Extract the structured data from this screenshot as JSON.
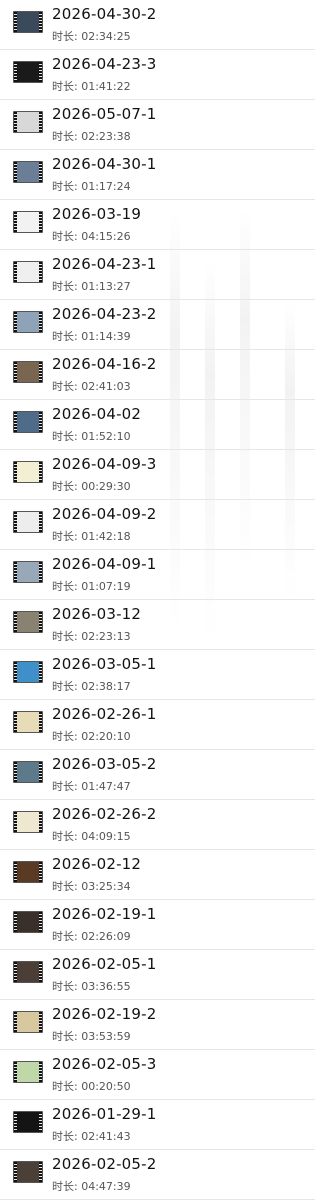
{
  "duration_prefix": "时长: ",
  "items": [
    {
      "title": "2026-04-30-2",
      "duration": "02:34:25",
      "thumb_color": "#3a4a5a"
    },
    {
      "title": "2026-04-23-3",
      "duration": "01:41:22",
      "thumb_color": "#1a1a1a"
    },
    {
      "title": "2026-05-07-1",
      "duration": "02:23:38",
      "thumb_color": "#d8d8d8"
    },
    {
      "title": "2026-04-30-1",
      "duration": "01:17:24",
      "thumb_color": "#6a7f96"
    },
    {
      "title": "2026-03-19",
      "duration": "04:15:26",
      "thumb_color": "#f2f2f2"
    },
    {
      "title": "2026-04-23-1",
      "duration": "01:13:27",
      "thumb_color": "#efefef"
    },
    {
      "title": "2026-04-23-2",
      "duration": "01:14:39",
      "thumb_color": "#8fa3b8"
    },
    {
      "title": "2026-04-16-2",
      "duration": "02:41:03",
      "thumb_color": "#7a6650"
    },
    {
      "title": "2026-04-02",
      "duration": "01:52:10",
      "thumb_color": "#4f6b8a"
    },
    {
      "title": "2026-04-09-3",
      "duration": "00:29:30",
      "thumb_color": "#f3efd2"
    },
    {
      "title": "2026-04-09-2",
      "duration": "01:42:18",
      "thumb_color": "#ededed"
    },
    {
      "title": "2026-04-09-1",
      "duration": "01:07:19",
      "thumb_color": "#98a8b8"
    },
    {
      "title": "2026-03-12",
      "duration": "02:23:13",
      "thumb_color": "#8a8270"
    },
    {
      "title": "2026-03-05-1",
      "duration": "02:38:17",
      "thumb_color": "#3f8fc8"
    },
    {
      "title": "2026-02-26-1",
      "duration": "02:20:10",
      "thumb_color": "#e8dcb8"
    },
    {
      "title": "2026-03-05-2",
      "duration": "01:47:47",
      "thumb_color": "#5d7a8a"
    },
    {
      "title": "2026-02-26-2",
      "duration": "04:09:15",
      "thumb_color": "#efe8d0"
    },
    {
      "title": "2026-02-12",
      "duration": "03:25:34",
      "thumb_color": "#5a3a22"
    },
    {
      "title": "2026-02-19-1",
      "duration": "02:26:09",
      "thumb_color": "#3a302a"
    },
    {
      "title": "2026-02-05-1",
      "duration": "03:36:55",
      "thumb_color": "#4a3e36"
    },
    {
      "title": "2026-02-19-2",
      "duration": "03:53:59",
      "thumb_color": "#d8c8a0"
    },
    {
      "title": "2026-02-05-3",
      "duration": "00:20:50",
      "thumb_color": "#c0d8a8"
    },
    {
      "title": "2026-01-29-1",
      "duration": "02:41:43",
      "thumb_color": "#141414"
    },
    {
      "title": "2026-02-05-2",
      "duration": "04:47:39",
      "thumb_color": "#4a4038"
    }
  ]
}
